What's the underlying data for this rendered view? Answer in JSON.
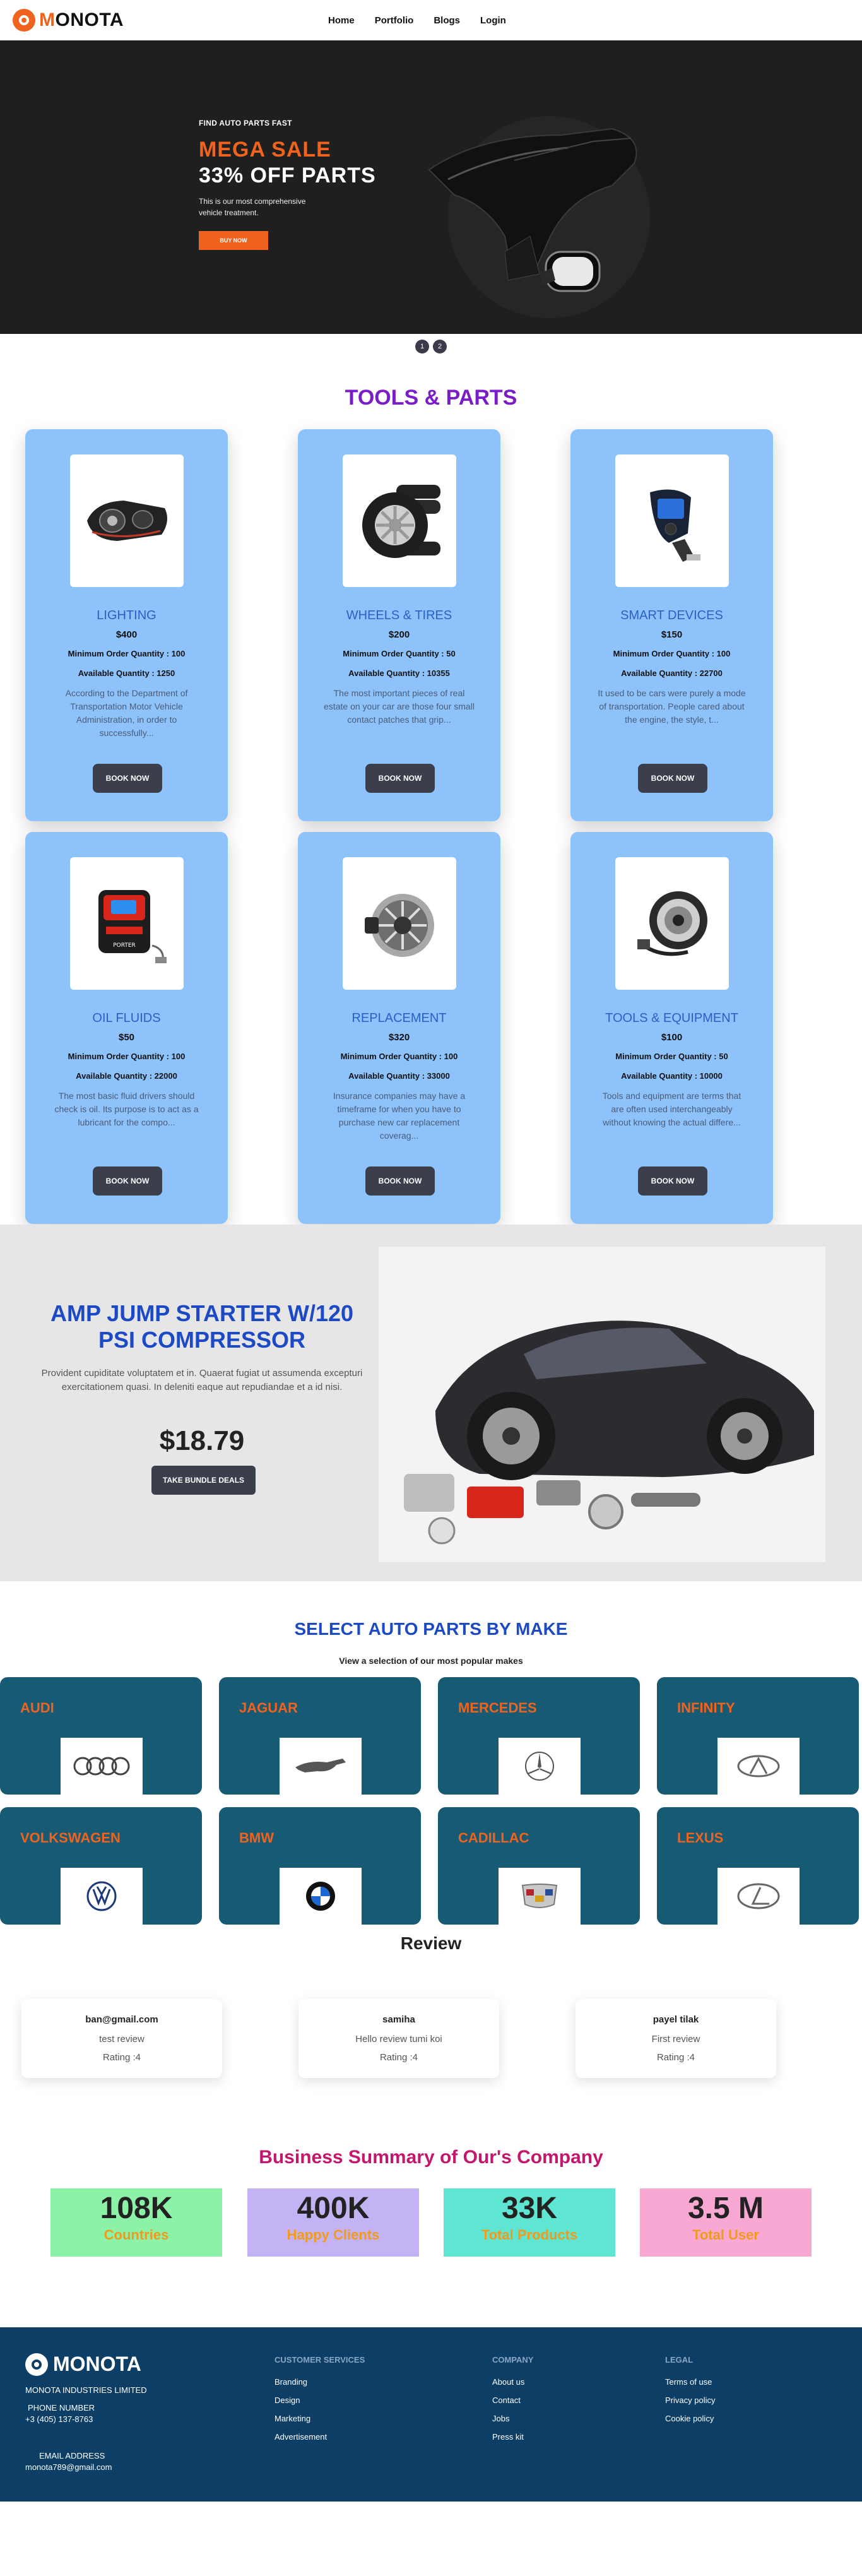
{
  "nav": {
    "logo_m": "M",
    "logo_rest": "ONOTA",
    "links": [
      "Home",
      "Portfolio",
      "Blogs",
      "Login"
    ]
  },
  "hero": {
    "kicker": "FIND AUTO PARTS FAST",
    "title": "MEGA SALE",
    "subtitle": "33% OFF PARTS",
    "description": "This is our most comprehensive vehicle treatment.",
    "button": "BUY NOW",
    "slides": [
      "1",
      "2"
    ]
  },
  "tools": {
    "title": "TOOLS & PARTS",
    "min_label": "Minimum Order Quantity : ",
    "avail_label": "Available Quantity : ",
    "button": "BOOK NOW",
    "items": [
      {
        "name": "LIGHTING",
        "price": "$400",
        "min": "100",
        "available": "1250",
        "description": "According to the Department of Transportation Motor Vehicle Administration, in order to successfully...",
        "icon": "headlight-icon"
      },
      {
        "name": "WHEELS & TIRES",
        "price": "$200",
        "min": "50",
        "available": "10355",
        "description": "The most important pieces of real estate on your car are those four small contact patches that grip...",
        "icon": "tires-icon"
      },
      {
        "name": "SMART DEVICES",
        "price": "$150",
        "min": "100",
        "available": "22700",
        "description": "It used to be cars were purely a mode of transportation. People cared about the engine, the style, t...",
        "icon": "fm-transmitter-icon"
      },
      {
        "name": "OIL FLUIDS",
        "price": "$50",
        "min": "100",
        "available": "22000",
        "description": "The most basic fluid drivers should check is oil. Its purpose is to act as a lubricant for the compo...",
        "icon": "jump-starter-icon"
      },
      {
        "name": "REPLACEMENT",
        "price": "$320",
        "min": "100",
        "available": "33000",
        "description": "Insurance companies may have a timeframe for when you have to purchase new car replacement coverag...",
        "icon": "alternator-icon"
      },
      {
        "name": "TOOLS & EQUIPMENT",
        "price": "$100",
        "min": "50",
        "available": "10000",
        "description": "Tools and equipment are terms that are often used interchangeably without knowing the actual differe...",
        "icon": "hub-icon"
      }
    ]
  },
  "promo": {
    "title": "AMP JUMP STARTER W/120 PSI COMPRESSOR",
    "description": "Provident cupiditate voluptatem et in. Quaerat fugiat ut assumenda excepturi exercitationem quasi. In deleniti eaque aut repudiandae et a id nisi.",
    "price": "$18.79",
    "button": "TAKE BUNDLE DEALS"
  },
  "makes": {
    "title": "SELECT AUTO PARTS BY MAKE",
    "subtitle": "View a selection of our most popular makes",
    "items": [
      {
        "name": "AUDI",
        "icon": "audi-logo-icon"
      },
      {
        "name": "JAGUAR",
        "icon": "jaguar-logo-icon"
      },
      {
        "name": "MERCEDES",
        "icon": "mercedes-logo-icon"
      },
      {
        "name": "INFINITY",
        "icon": "infiniti-logo-icon"
      },
      {
        "name": "VOLKSWAGEN",
        "icon": "volkswagen-logo-icon"
      },
      {
        "name": "BMW",
        "icon": "bmw-logo-icon"
      },
      {
        "name": "CADILLAC",
        "icon": "cadillac-logo-icon"
      },
      {
        "name": "LEXUS",
        "icon": "lexus-logo-icon"
      }
    ]
  },
  "reviews": {
    "title": "Review",
    "rating_label": "Rating :",
    "items": [
      {
        "user": "ban@gmail.com",
        "text": "test review",
        "rating": "4"
      },
      {
        "user": "samiha",
        "text": "Hello review tumi koi",
        "rating": "4"
      },
      {
        "user": "payel tilak",
        "text": "First review",
        "rating": "4"
      }
    ]
  },
  "summary": {
    "title": "Business Summary of Our's Company",
    "stats": [
      {
        "value": "108K",
        "label": "Countries",
        "color": "#8cf2a8"
      },
      {
        "value": "400K",
        "label": "Happy Clients",
        "color": "#c3b3f5"
      },
      {
        "value": "33K",
        "label": "Total Products",
        "color": "#5fe6d2"
      },
      {
        "value": "3.5 M",
        "label": "Total User",
        "color": "#f9a8d3"
      }
    ]
  },
  "footer": {
    "brand": "MONOTA",
    "company": "MONOTA INDUSTRIES LIMITED",
    "phone_label": "PHONE NUMBER",
    "phone": "+3 (405) 137-8763",
    "email_label": "EMAIL ADDRESS",
    "email": "monota789@gmail.com",
    "columns": [
      {
        "heading": "CUSTOMER SERVICES",
        "links": [
          "Branding",
          "Design",
          "Marketing",
          "Advertisement"
        ]
      },
      {
        "heading": "COMPANY",
        "links": [
          "About us",
          "Contact",
          "Jobs",
          "Press kit"
        ]
      },
      {
        "heading": "LEGAL",
        "links": [
          "Terms of use",
          "Privacy policy",
          "Cookie policy"
        ]
      }
    ]
  },
  "colors": {
    "accent": "#f0631e",
    "card_bg": "#8ec2fb",
    "make_bg": "#175a74",
    "footer_bg": "#0d3f66",
    "tools_title": "#7a1cc7",
    "blue_title": "#1c49c6",
    "summary_title": "#c4166c"
  }
}
